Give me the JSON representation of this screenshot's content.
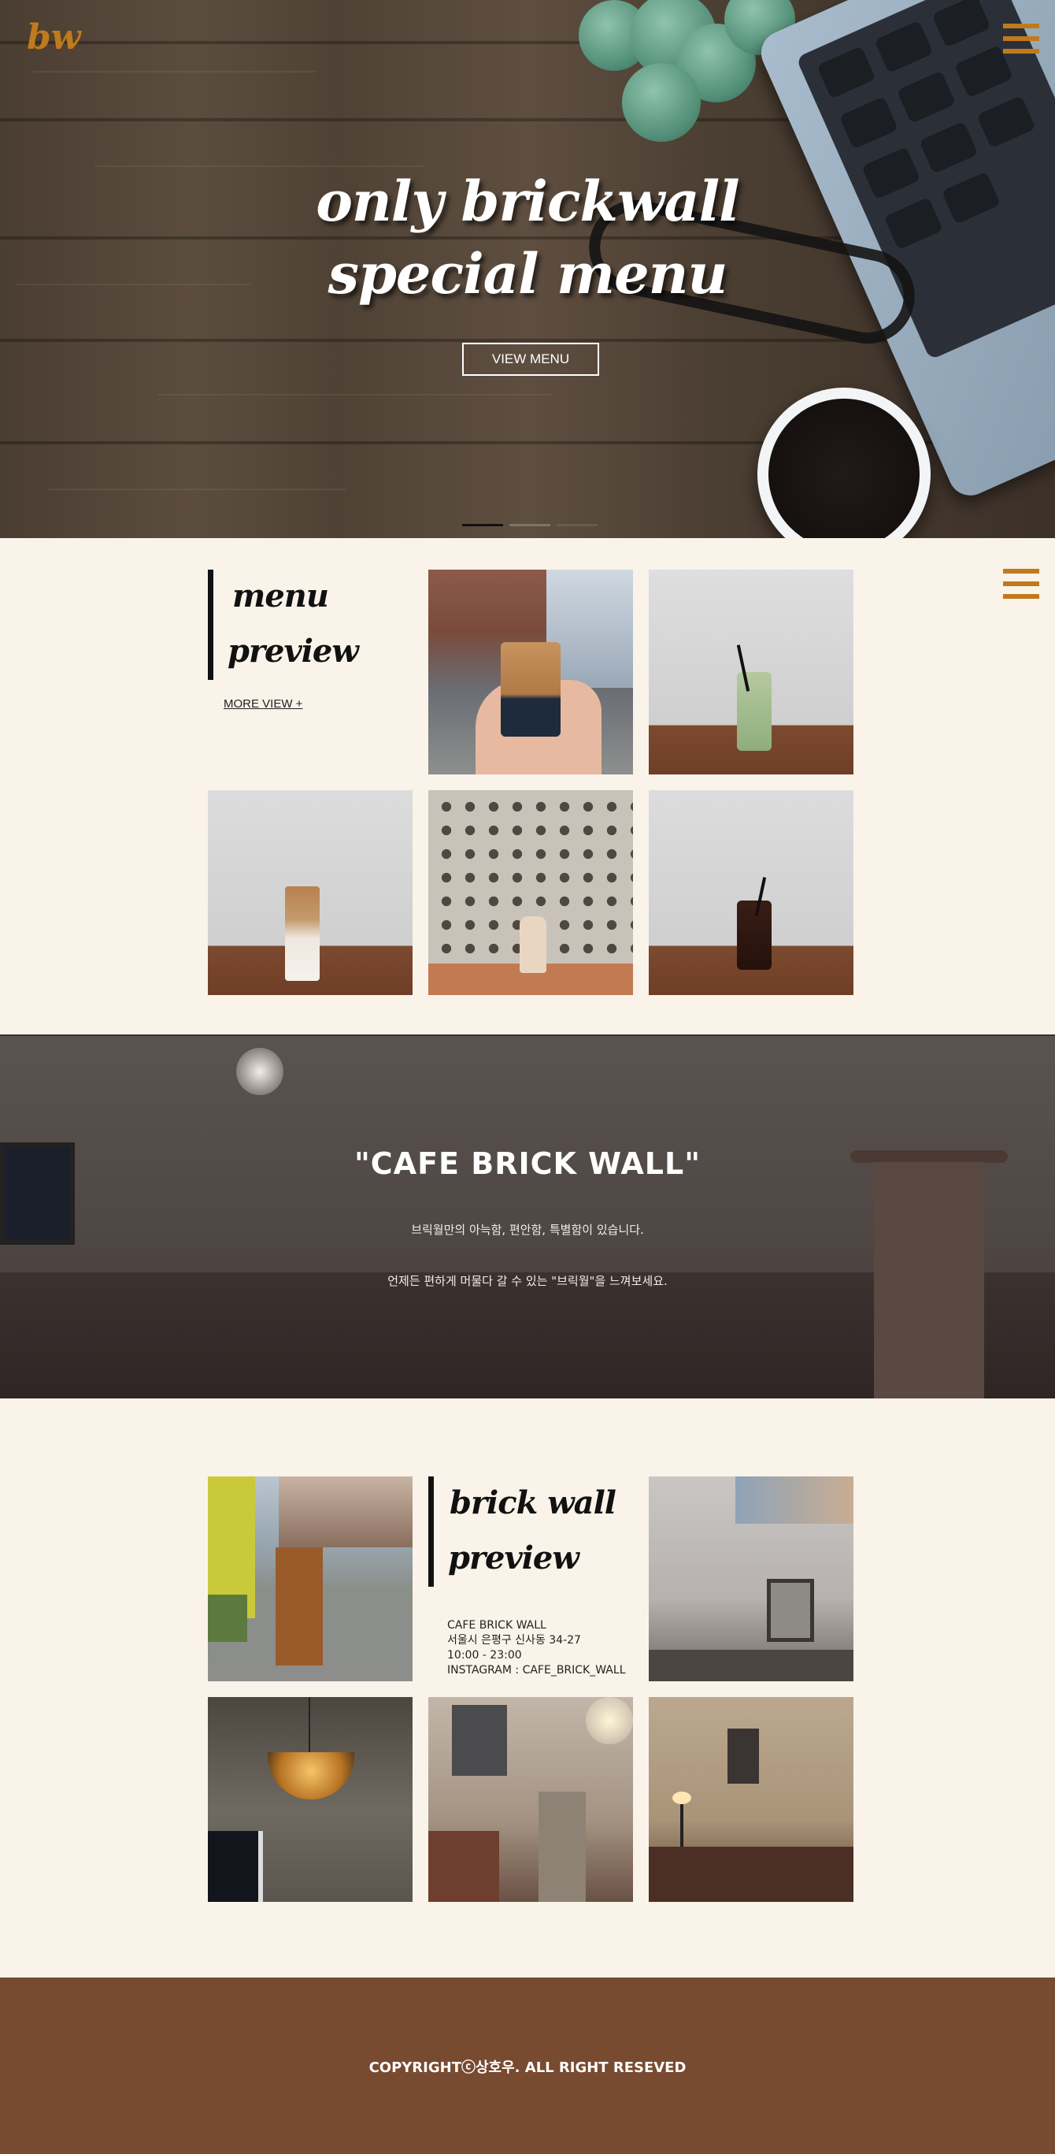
{
  "header": {
    "logo_text": "bw",
    "menu_icon": "hamburger-icon",
    "accent_color": "#c07a1c"
  },
  "hero": {
    "title": "only brickwall\nspecial menu",
    "button_label": "VIEW MENU",
    "slides_total": 3,
    "active_slide": 1
  },
  "menu_preview": {
    "title_line1": "menu",
    "title_line2": "preview",
    "more_link": "MORE VIEW +",
    "photos": [
      "iced-coffee-in-hand",
      "green-tea-latte",
      "iced-latte",
      "bottled-milk-tea",
      "iced-americano"
    ]
  },
  "banner": {
    "title": "\"CAFE BRICK WALL\"",
    "line1": "브릭월만의 아늑함, 편안함, 특별함이 있습니다.",
    "line2": "언제든 편하게 머물다 갈 수 있는 \"브릭월\"을 느껴보세요."
  },
  "brick_wall_preview": {
    "title_line1": "brick wall",
    "title_line2": "preview",
    "info": {
      "name": "CAFE BRICK WALL",
      "address": "서울시 은평구 신사동 34-27",
      "hours": "10:00 - 23:00",
      "instagram": "INSTAGRAM : CAFE_BRICK_WALL"
    },
    "photos": [
      "storefront-sign",
      "interior-projector",
      "pendant-lamp",
      "interior-seating",
      "interior-lamp-corner"
    ]
  },
  "footer": {
    "copyright": "COPYRIGHTⓒ상호우. ALL RIGHT RESEVED",
    "background_color": "#784a30"
  }
}
